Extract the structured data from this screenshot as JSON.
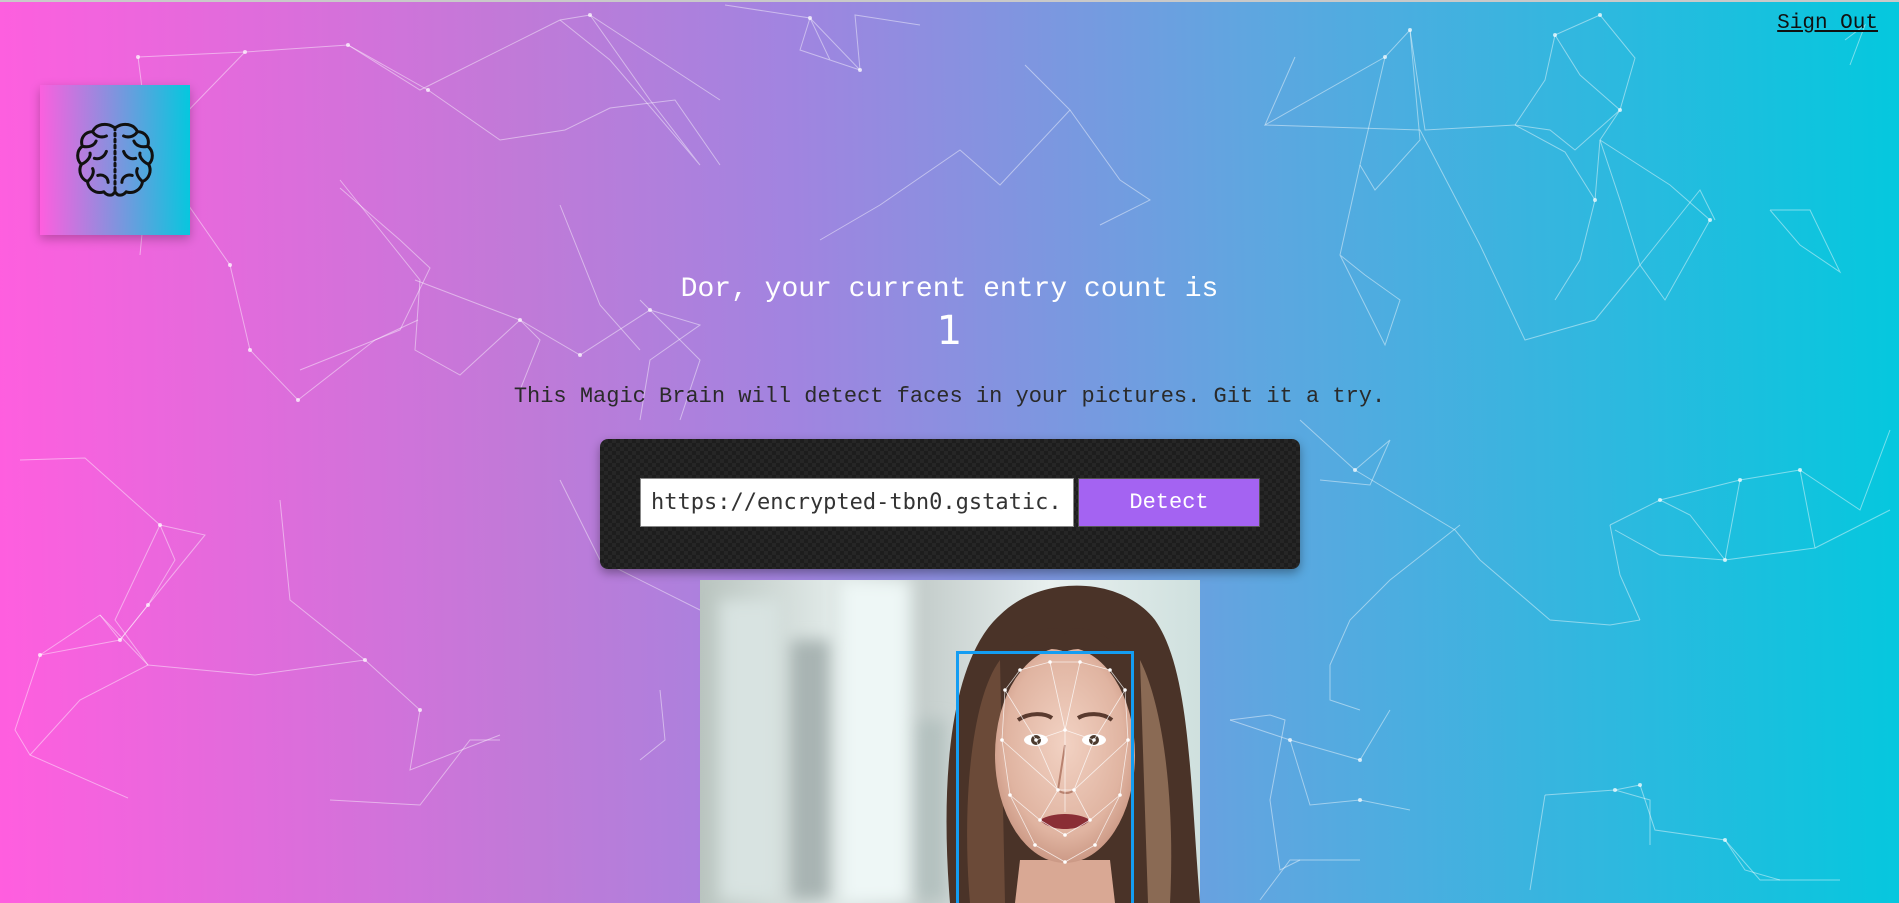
{
  "nav": {
    "signout_label": "Sign Out"
  },
  "logo": {
    "icon": "brain-icon"
  },
  "rank": {
    "message": "Dor, your current entry count is",
    "count": "1"
  },
  "tagline": "This Magic Brain will detect faces in your pictures. Git it a try.",
  "image_form": {
    "input_value": "https://encrypted-tbn0.gstatic.com/images",
    "button_label": "Detect"
  },
  "result": {
    "image_alt": "face-photo",
    "face_box_color": "#149df2"
  },
  "colors": {
    "gradient_start": "#ff5edf",
    "gradient_end": "#04c8de",
    "button": "#a463f2"
  }
}
